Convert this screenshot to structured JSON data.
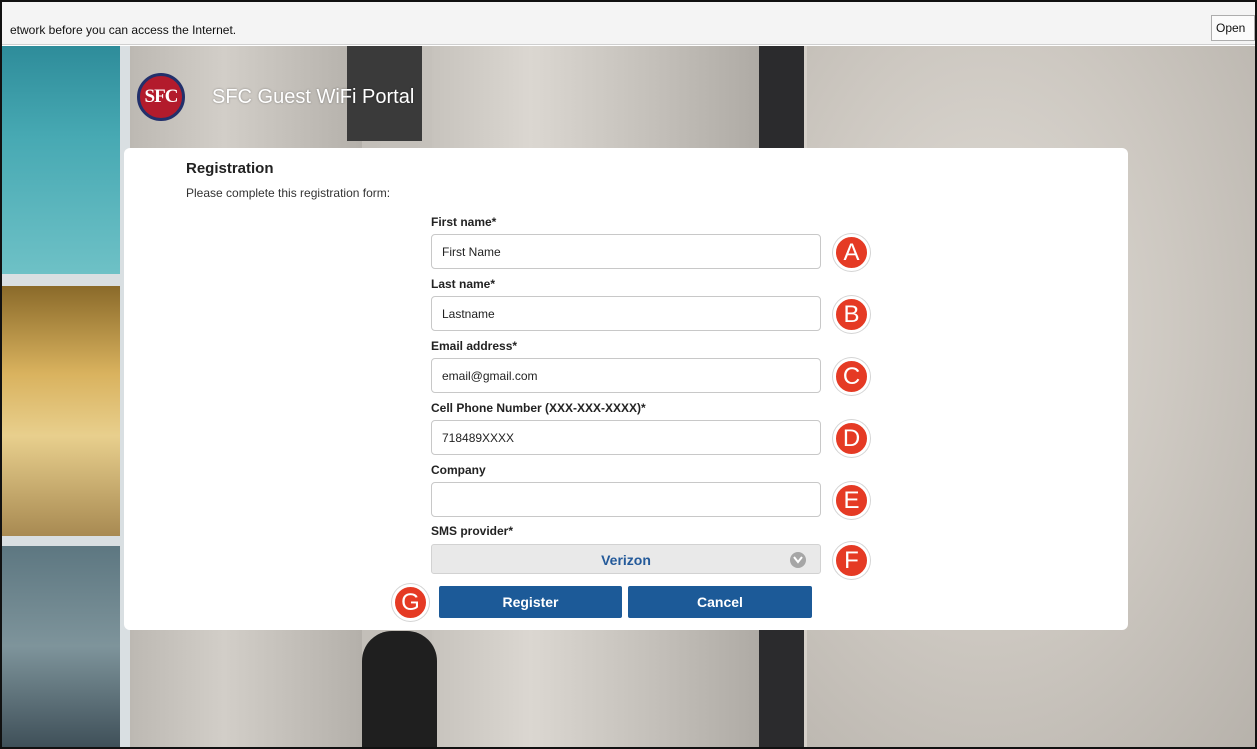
{
  "notification": {
    "text": "etwork before you can access the Internet.",
    "open_button": "Open"
  },
  "header": {
    "logo_text": "SFC",
    "title": "SFC Guest WiFi Portal"
  },
  "form": {
    "title": "Registration",
    "subtitle": "Please complete this registration form:",
    "first_name": {
      "label": "First name*",
      "value": "First Name"
    },
    "last_name": {
      "label": "Last name*",
      "value": "Lastname"
    },
    "email": {
      "label": "Email address*",
      "value": "email@gmail.com"
    },
    "phone": {
      "label": "Cell Phone Number (XXX-XXX-XXXX)*",
      "value": "718489XXXX"
    },
    "company": {
      "label": "Company",
      "value": ""
    },
    "sms_provider": {
      "label": "SMS provider*",
      "selected": "Verizon"
    },
    "register_button": "Register",
    "cancel_button": "Cancel"
  },
  "annotations": [
    "A",
    "B",
    "C",
    "D",
    "E",
    "F",
    "G"
  ],
  "colors": {
    "primary_button": "#1c5a98",
    "badge": "#e53a24",
    "logo": "#b31b2c"
  }
}
